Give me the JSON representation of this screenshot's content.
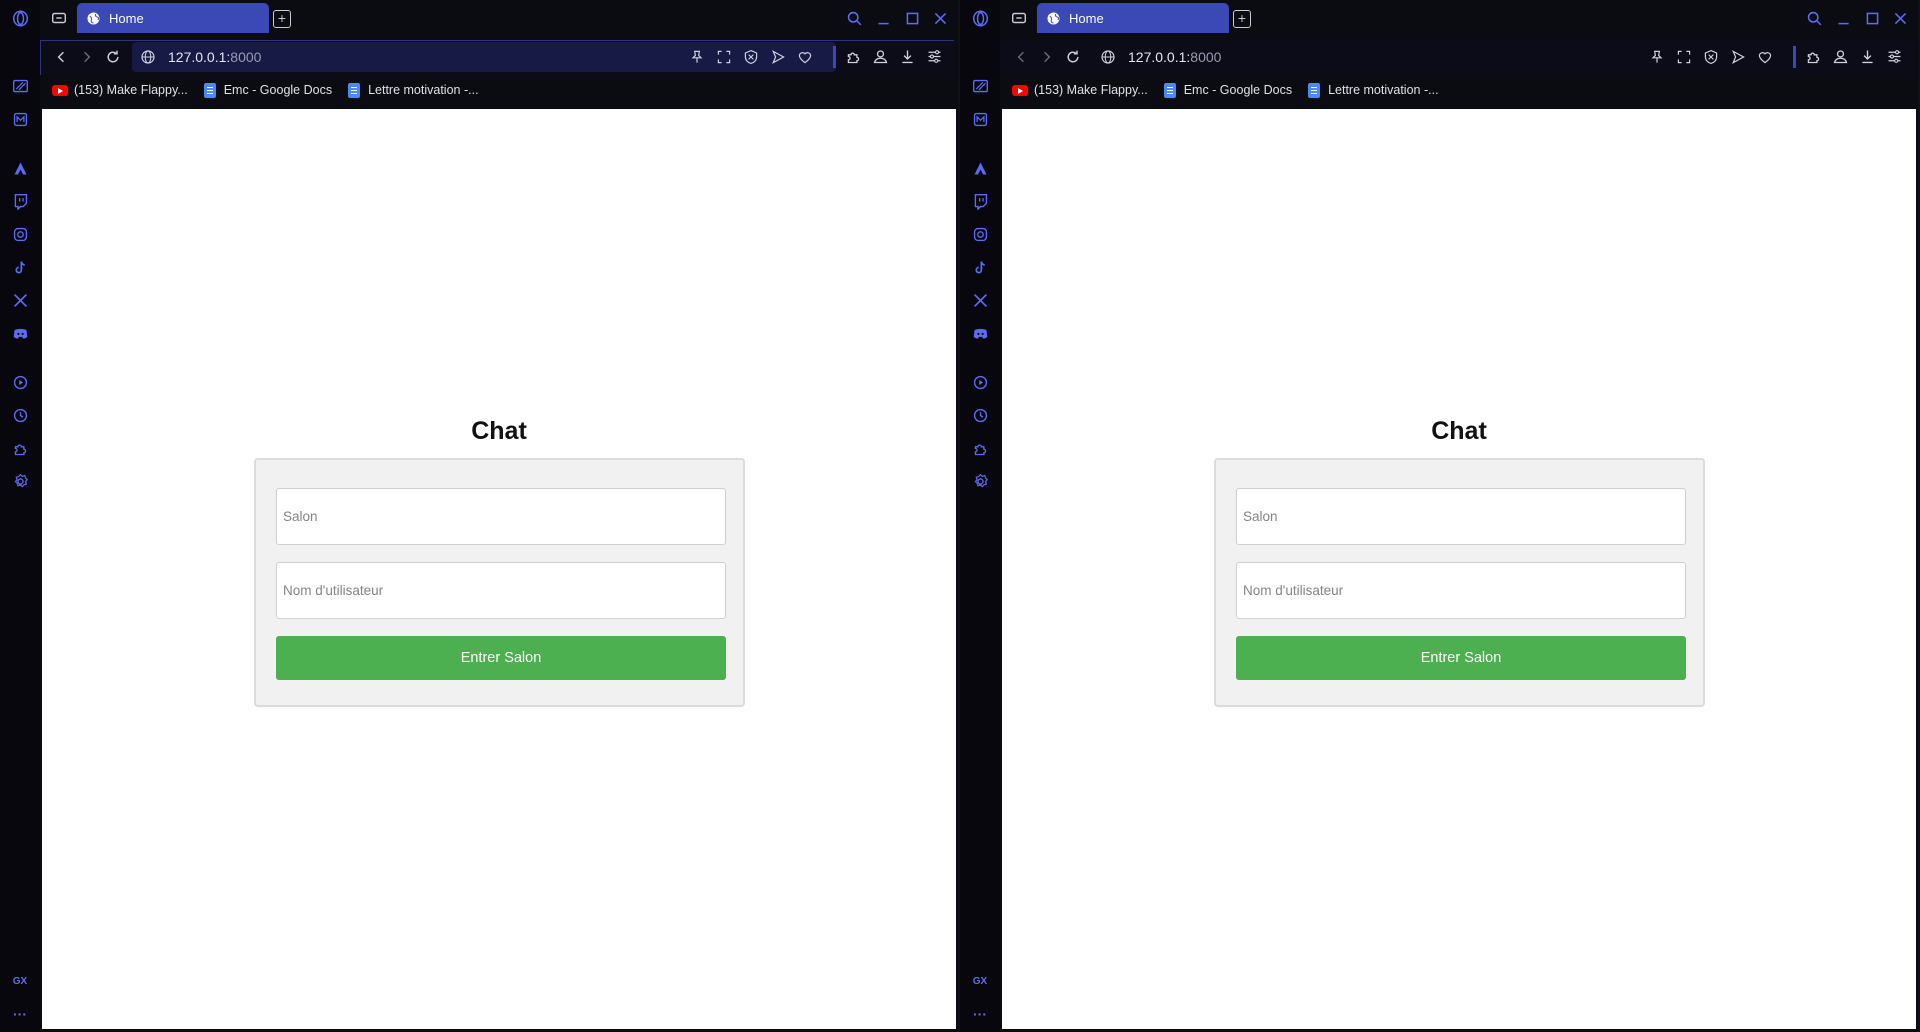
{
  "browser": {
    "tab_title": "Home",
    "url_host": "127.0.0.1:",
    "url_port": "8000",
    "accent_color": "#3a49b5",
    "sidebar_icons": [
      "speed-dial-icon",
      "messenger-icon",
      "aria-icon",
      "twitch-icon",
      "instagram-icon",
      "tiktok-icon",
      "x-icon",
      "discord-icon",
      "player-icon",
      "history-icon",
      "extensions-icon",
      "settings-icon"
    ],
    "sidebar_bottom_label": "GX",
    "sidebar_more": "···"
  },
  "bookmarks": [
    {
      "label": "(153) Make Flappy...",
      "icon": "youtube-icon"
    },
    {
      "label": "Emc - Google Docs",
      "icon": "google-docs-icon"
    },
    {
      "label": "Lettre motivation -...",
      "icon": "google-docs-icon"
    }
  ],
  "page": {
    "title": "Chat",
    "salon_placeholder": "Salon",
    "username_placeholder": "Nom d'utilisateur",
    "submit_label": "Entrer Salon",
    "button_color": "#4caf50"
  }
}
